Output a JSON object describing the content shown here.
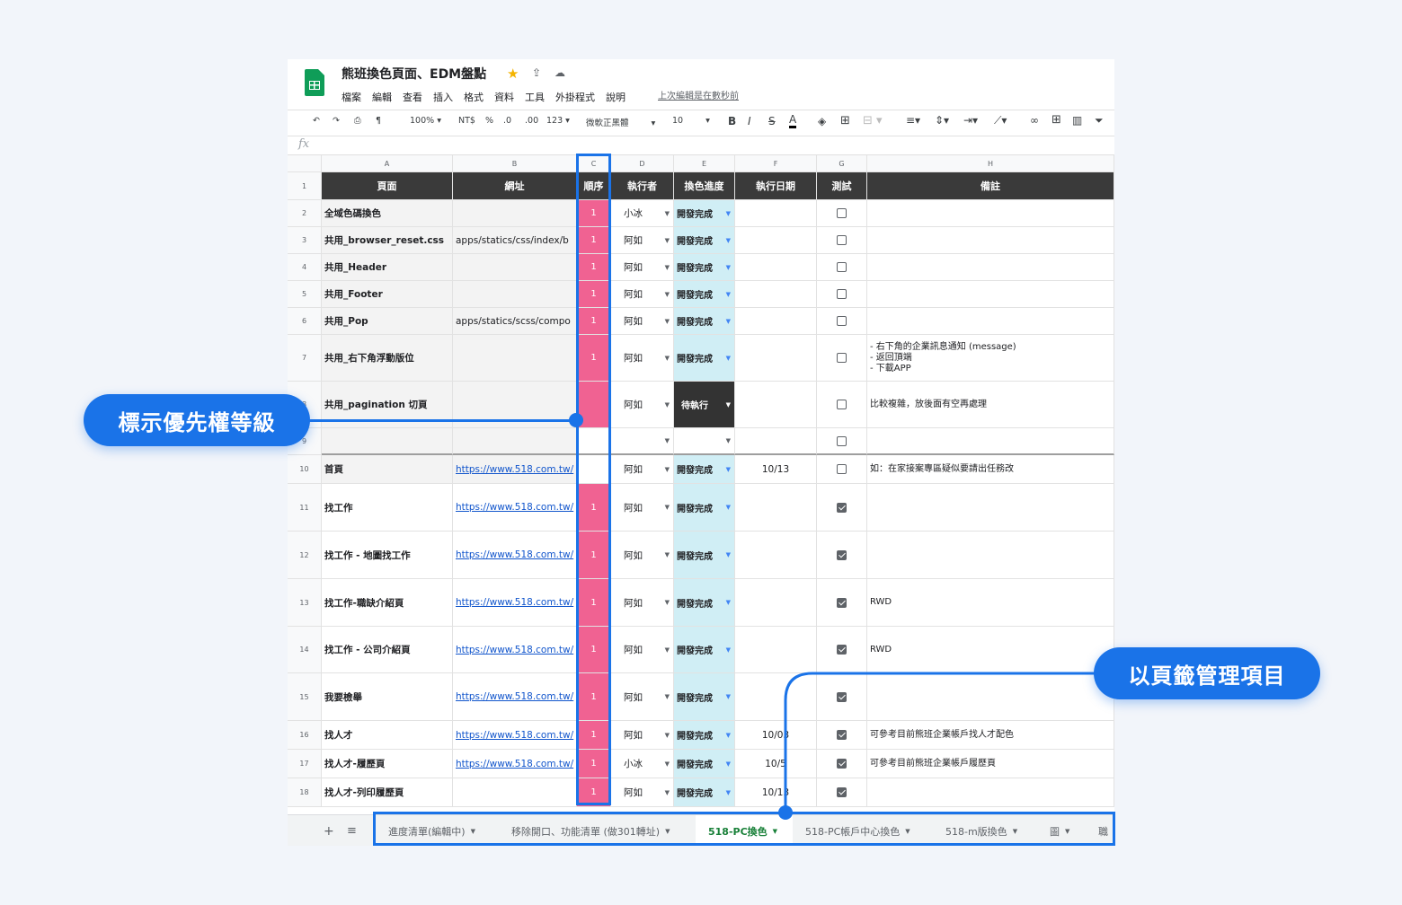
{
  "doc": {
    "title": "熊班換色頁面、EDM盤點",
    "star_icon": "star-icon",
    "menu": [
      "檔案",
      "編輯",
      "查看",
      "插入",
      "格式",
      "資料",
      "工具",
      "外掛程式",
      "說明"
    ],
    "last_edit": "上次編輯是在數秒前"
  },
  "toolbar": {
    "zoom": "100%",
    "currency": "NT$",
    "percent": "%",
    "dec_dec": ".0",
    "dec_inc": ".00",
    "format": "123",
    "font": "微軟正黑體",
    "font_size": "10",
    "bold": "B",
    "italic": "I",
    "strike": "S",
    "text_color": "A"
  },
  "formula_bar": {
    "fx": "fx"
  },
  "columns": [
    "A",
    "B",
    "C",
    "D",
    "E",
    "F",
    "G",
    "H"
  ],
  "headers": [
    "頁面",
    "網址",
    "順序",
    "執行者",
    "換色進度",
    "執行日期",
    "測試",
    "備註"
  ],
  "rows": [
    {
      "num": "2",
      "page": "全域色碼換色",
      "url": "",
      "order": "1",
      "owner": "小冰",
      "status": "開發完成",
      "date": "",
      "checked": false,
      "note": ""
    },
    {
      "num": "3",
      "page": "共用_browser_reset.css",
      "url": "apps/statics/css/index/b",
      "order": "1",
      "owner": "阿如",
      "status": "開發完成",
      "date": "",
      "checked": false,
      "note": ""
    },
    {
      "num": "4",
      "page": "共用_Header",
      "url": "",
      "order": "1",
      "owner": "阿如",
      "status": "開發完成",
      "date": "",
      "checked": false,
      "note": ""
    },
    {
      "num": "5",
      "page": "共用_Footer",
      "url": "",
      "order": "1",
      "owner": "阿如",
      "status": "開發完成",
      "date": "",
      "checked": false,
      "note": ""
    },
    {
      "num": "6",
      "page": "共用_Pop",
      "url": "apps/statics/scss/compo",
      "order": "1",
      "owner": "阿如",
      "status": "開發完成",
      "date": "",
      "checked": false,
      "note": ""
    },
    {
      "num": "7",
      "page": "共用_右下角浮動版位",
      "url": "",
      "order": "1",
      "owner": "阿如",
      "status": "開發完成",
      "date": "",
      "checked": false,
      "note": "- 右下角的企業訊息通知 (message)\n- 返回頂端\n- 下載APP"
    },
    {
      "num": "8",
      "page": "共用_pagination 切頁",
      "url": "",
      "order": "",
      "owner": "阿如",
      "status": "待執行",
      "date": "",
      "checked": false,
      "note": "比較複雜，放後面有空再處理"
    },
    {
      "num": "9",
      "page": "",
      "url": "",
      "order": "",
      "owner": "",
      "status": "",
      "date": "",
      "checked": false,
      "note": ""
    },
    {
      "num": "10",
      "page": "首頁",
      "url": "https://www.518.com.tw/",
      "order": "",
      "owner": "阿如",
      "status": "開發完成",
      "date": "10/13",
      "checked": false,
      "note": "如：在家接案專區疑似要請出任務改"
    },
    {
      "num": "11",
      "page": "找工作",
      "url": "https://www.518.com.tw/",
      "order": "1",
      "owner": "阿如",
      "status": "開發完成",
      "date": "",
      "checked": true,
      "note": ""
    },
    {
      "num": "12",
      "page": "找工作 - 地圖找工作",
      "url": "https://www.518.com.tw/",
      "order": "1",
      "owner": "阿如",
      "status": "開發完成",
      "date": "",
      "checked": true,
      "note": ""
    },
    {
      "num": "13",
      "page": "找工作-職缺介紹頁",
      "url": "https://www.518.com.tw/",
      "order": "1",
      "owner": "阿如",
      "status": "開發完成",
      "date": "",
      "checked": true,
      "note": "RWD"
    },
    {
      "num": "14",
      "page": "找工作 - 公司介紹頁",
      "url": "https://www.518.com.tw/",
      "order": "1",
      "owner": "阿如",
      "status": "開發完成",
      "date": "",
      "checked": true,
      "note": "RWD"
    },
    {
      "num": "15",
      "page": "我要檢舉",
      "url": "https://www.518.com.tw/",
      "order": "1",
      "owner": "阿如",
      "status": "開發完成",
      "date": "",
      "checked": true,
      "note": ""
    },
    {
      "num": "16",
      "page": "找人才",
      "url": "https://www.518.com.tw/",
      "order": "1",
      "owner": "阿如",
      "status": "開發完成",
      "date": "10/03",
      "checked": true,
      "note": "可參考目前熊班企業帳戶找人才配色"
    },
    {
      "num": "17",
      "page": "找人才-履歷頁",
      "url": "https://www.518.com.tw/",
      "order": "1",
      "owner": "小冰",
      "status": "開發完成",
      "date": "10/5",
      "checked": true,
      "note": "可參考目前熊班企業帳戶履歷頁"
    },
    {
      "num": "18",
      "page": "找人才-列印履歷頁",
      "url": "",
      "order": "1",
      "owner": "阿如",
      "status": "開發完成",
      "date": "10/13",
      "checked": true,
      "note": ""
    }
  ],
  "sheet_tabs": {
    "add": "+",
    "list": "≡",
    "tabs": [
      "進度清單(編輯中)",
      "移除開口、功能清單 (做301轉址)",
      "518-PC換色",
      "518-PC帳戶中心換色",
      "518-m版換色",
      "圖",
      "職"
    ],
    "active_index": 2
  },
  "callouts": {
    "priority": "標示優先權等級",
    "tabs": "以頁籤管理項目"
  },
  "colors": {
    "accent": "#1a73e8",
    "priority_pink": "#f06292",
    "status_cyan": "#d0eef5",
    "header_dark": "#3a3a3a",
    "active_tab_green": "#188038"
  }
}
